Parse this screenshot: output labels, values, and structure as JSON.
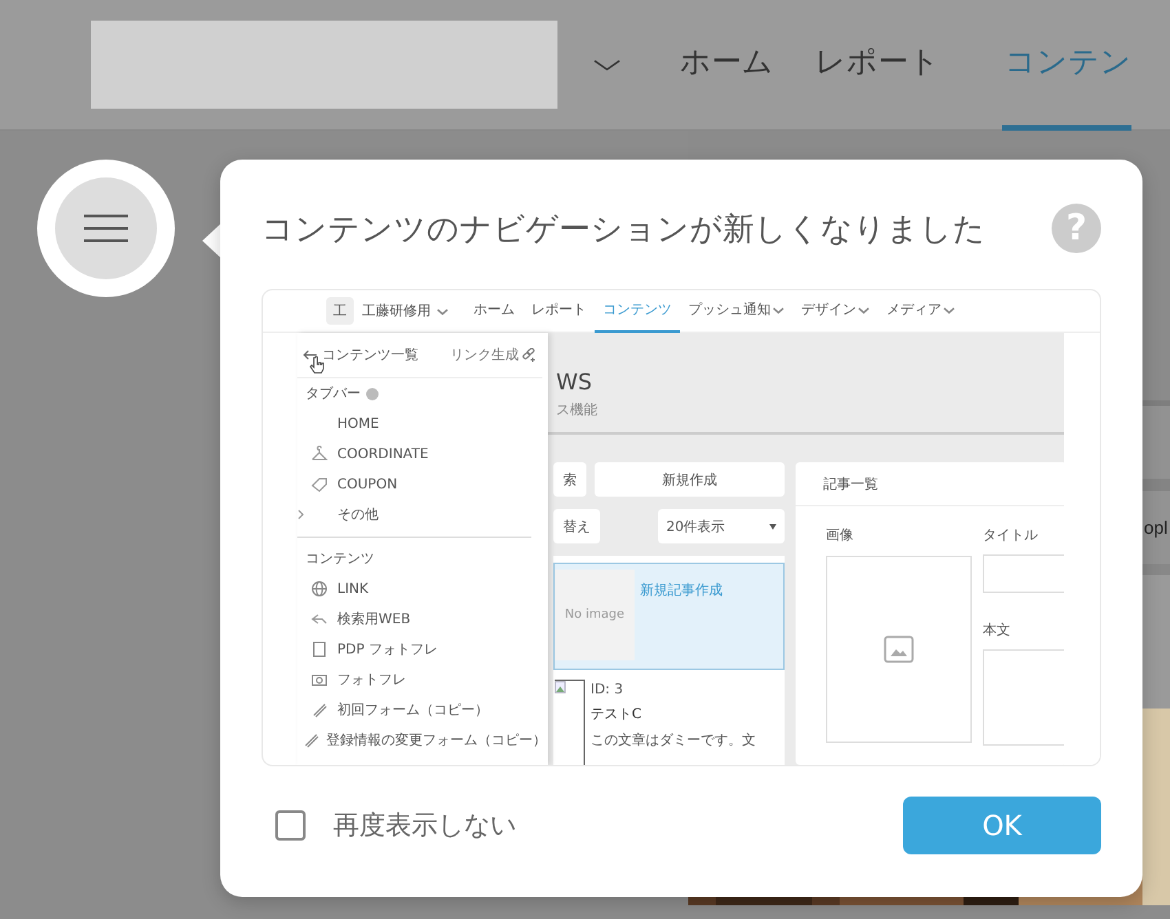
{
  "header": {
    "nav": [
      {
        "label": "ホーム",
        "selected": false
      },
      {
        "label": "レポート",
        "selected": false
      },
      {
        "label": "コンテン",
        "selected": true
      }
    ]
  },
  "background": {
    "side_text": "opl"
  },
  "dialog": {
    "title": "コンテンツのナビゲーションが新しくなりました",
    "help": "?",
    "preview": {
      "brand_initial": "工",
      "account": "工藤研修用",
      "nav": [
        {
          "label": "ホーム",
          "selected": false,
          "dropdown": false
        },
        {
          "label": "レポート",
          "selected": false,
          "dropdown": false
        },
        {
          "label": "コンテンツ",
          "selected": true,
          "dropdown": false
        },
        {
          "label": "プッシュ通知",
          "selected": false,
          "dropdown": true
        },
        {
          "label": "デザイン",
          "selected": false,
          "dropdown": true
        },
        {
          "label": "メディア",
          "selected": false,
          "dropdown": true
        }
      ],
      "sidebar": {
        "back_label": "コンテンツ一覧",
        "link_label": "リンク生成",
        "sections": [
          {
            "title": "タブバー",
            "help": true,
            "items": [
              {
                "label": "HOME",
                "kind": "plain",
                "expandable": false
              },
              {
                "label": "COORDINATE",
                "kind": "hanger",
                "expandable": false
              },
              {
                "label": "COUPON",
                "kind": "tag",
                "expandable": false
              },
              {
                "label": "その他",
                "kind": "more",
                "expandable": true
              }
            ]
          },
          {
            "title": "コンテンツ",
            "help": false,
            "items": [
              {
                "label": "LINK",
                "kind": "globe",
                "expandable": false
              },
              {
                "label": "検索用WEB",
                "kind": "arrow",
                "expandable": false
              },
              {
                "label": "PDP フォトフレ",
                "kind": "page",
                "expandable": false
              },
              {
                "label": "フォトフレ",
                "kind": "camera",
                "expandable": false
              },
              {
                "label": "初回フォーム（コピー）",
                "kind": "form",
                "expandable": false
              },
              {
                "label": "登録情報の変更フォーム（コピー）",
                "kind": "form",
                "expandable": false
              }
            ]
          }
        ]
      },
      "page_title": "WS",
      "page_subtitle": "ス機能",
      "search_button": "索",
      "new_button": "新規作成",
      "sort_button": "替え",
      "per_page": "20件表示",
      "articles": [
        {
          "kind": "new",
          "image": "No image",
          "title": "新規記事作成",
          "selected": true
        },
        {
          "kind": "article",
          "id": "ID: 3",
          "title": "テストC",
          "excerpt": "この文章はダミーです。文",
          "selected": false
        }
      ],
      "detail": {
        "title": "記事一覧",
        "image_label": "画像",
        "title_label": "タイトル",
        "body_label": "本文"
      }
    },
    "dont_show_again": {
      "label": "再度表示しない",
      "checked": false
    },
    "ok_button": "OK"
  }
}
